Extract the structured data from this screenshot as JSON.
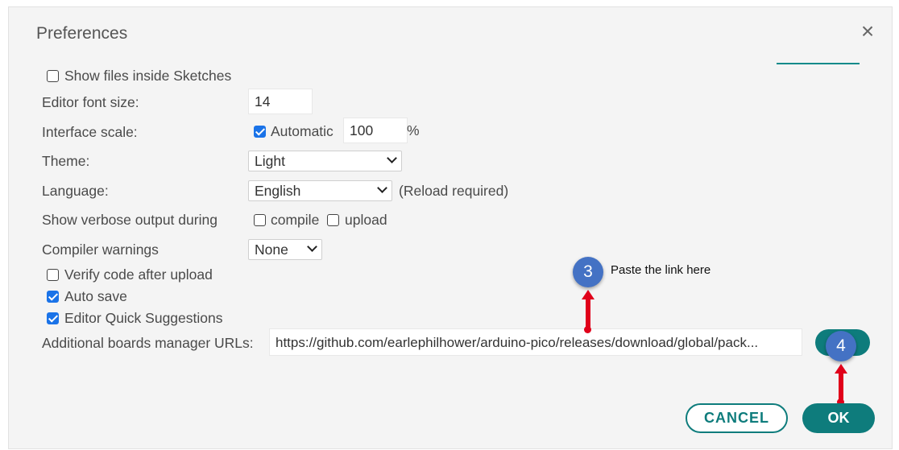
{
  "dialog": {
    "title": "Preferences",
    "close_icon": "close-icon"
  },
  "settings": {
    "show_files": {
      "label": "Show files inside Sketches",
      "checked": false
    },
    "font_size": {
      "label": "Editor font size:",
      "value": "14"
    },
    "interface_scale": {
      "label": "Interface scale:",
      "automatic_label": "Automatic",
      "automatic_checked": true,
      "value": "100",
      "unit": "%"
    },
    "theme": {
      "label": "Theme:",
      "selected": "Light"
    },
    "language": {
      "label": "Language:",
      "selected": "English",
      "note": "(Reload required)"
    },
    "verbose": {
      "label": "Show verbose output during",
      "compile_label": "compile",
      "upload_label": "upload"
    },
    "compiler_warnings": {
      "label": "Compiler warnings",
      "selected": "None"
    },
    "verify": {
      "label": "Verify code after upload",
      "checked": false
    },
    "auto_save": {
      "label": "Auto save",
      "checked": true
    },
    "quick_suggestions": {
      "label": "Editor Quick Suggestions",
      "checked": true
    },
    "boards_urls": {
      "label": "Additional boards manager URLs:",
      "value": "https://github.com/earlephilhower/arduino-pico/releases/download/global/pack..."
    }
  },
  "annotations": {
    "step3": {
      "number": "3",
      "text": "Paste the link here"
    },
    "step4": {
      "number": "4"
    }
  },
  "buttons": {
    "cancel": "CANCEL",
    "ok": "OK"
  },
  "colors": {
    "accent": "#0e7c7c",
    "check": "#1a73e8",
    "step": "#4472c4",
    "arrow": "#e0001a"
  }
}
